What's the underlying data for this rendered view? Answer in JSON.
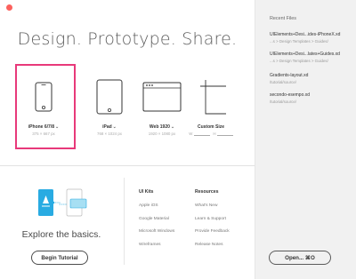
{
  "headline": "Design. Prototype. Share.",
  "presets": [
    {
      "name": "iPhone 6/7/8",
      "size": "375 × 667 px",
      "selected": true
    },
    {
      "name": "iPad",
      "size": "768 × 1024 px"
    },
    {
      "name": "Web 1920",
      "size": "1920 × 1080 px"
    },
    {
      "name": "Custom Size",
      "w_label": "W",
      "h_label": "H"
    }
  ],
  "explore": {
    "text": "Explore the basics.",
    "button": "Begin Tutorial"
  },
  "ui_kits": {
    "title": "UI Kits",
    "links": [
      "Apple iOS",
      "Google Material",
      "Microsoft Windows",
      "Wireframes"
    ]
  },
  "resources": {
    "title": "Resources",
    "links": [
      "What's New",
      "Learn & Support",
      "Provide Feedback",
      "Release Notes"
    ]
  },
  "sidebar": {
    "title": "Recent Files",
    "items": [
      {
        "name": "UIElements+Desi...ides-iPhoneX.xd",
        "path": "...s > Design Templates > Guides/"
      },
      {
        "name": "UIElements+Desi...lates+Guides.xd",
        "path": "...s > Design Templates > Guides/"
      },
      {
        "name": "Gradients-layout.xd",
        "path": "/tutorial/source/"
      },
      {
        "name": "secondo-esempo.xd",
        "path": "/tutorial/source/"
      }
    ],
    "open_button": "Open...   ⌘O"
  },
  "colors": {
    "accent": "#e8397a",
    "close": "#fc615d",
    "illustration_blue": "#29abe2"
  }
}
